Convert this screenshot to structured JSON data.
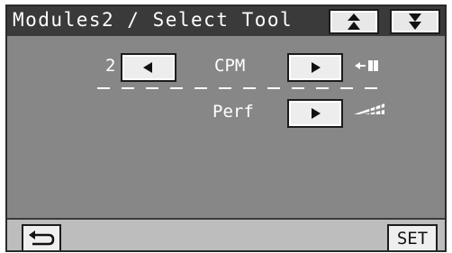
{
  "header": {
    "title": "Modules2 / Select Tool",
    "up_icon": "scroll-up-icon",
    "down_icon": "scroll-down-icon"
  },
  "rows": [
    {
      "value": "2",
      "label": "CPM",
      "left_icon": "arrow-left-icon",
      "right_icon": "arrow-right-icon",
      "tool_icon": "cpm-tool-icon"
    },
    {
      "label": "Perf",
      "right_icon": "arrow-right-icon",
      "tool_icon": "perf-tool-icon"
    }
  ],
  "footer": {
    "back_icon": "return-icon",
    "set_label": "SET"
  },
  "colors": {
    "screen_bg": "#878787",
    "titlebar_bg": "#3a3a3a",
    "button_bg": "#ededed",
    "footer_bg": "#bdbdbd"
  }
}
